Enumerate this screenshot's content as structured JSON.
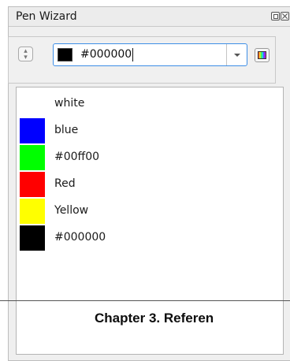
{
  "panel": {
    "title": "Pen Wizard",
    "title_buttons": [
      "float-icon",
      "close-icon"
    ]
  },
  "toolbar": {
    "spin_icon": "up-down-arrows-icon",
    "color_value": "#000000",
    "current_swatch": "#000000",
    "picker_icon": "color-picker-icon"
  },
  "pens": [
    {
      "label": "white",
      "color": "#ffffff"
    },
    {
      "label": "blue",
      "color": "#0000ff"
    },
    {
      "label": "#00ff00",
      "color": "#00ff00"
    },
    {
      "label": "Red",
      "color": "#ff0000"
    },
    {
      "label": "Yellow",
      "color": "#ffff00"
    },
    {
      "label": "#000000",
      "color": "#000000"
    }
  ],
  "page": {
    "heading": "Chapter 3.  Referen"
  }
}
